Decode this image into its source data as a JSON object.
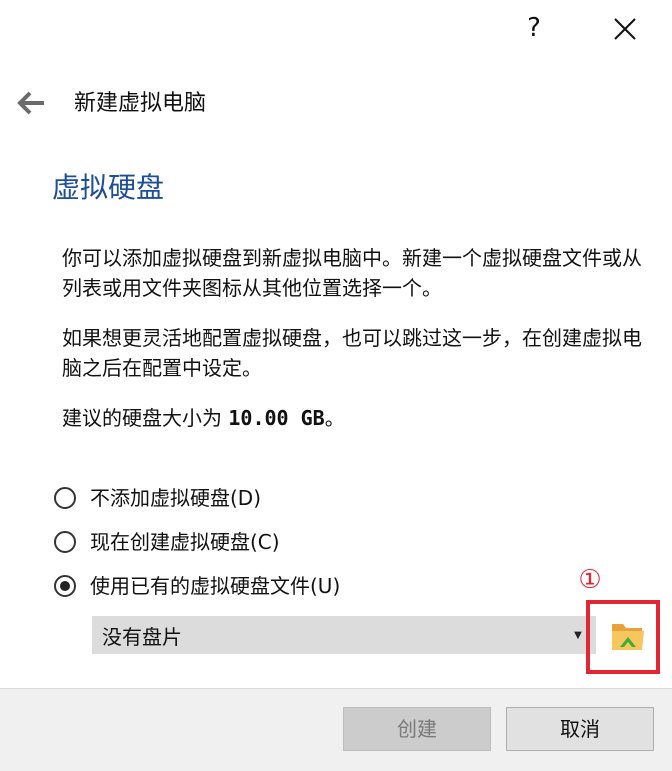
{
  "titlebar": {
    "help_label": "?",
    "close_icon": "close-icon"
  },
  "header": {
    "back_icon": "back-arrow-icon",
    "title": "新建虚拟电脑"
  },
  "section": {
    "title": "虚拟硬盘",
    "paragraph1": "你可以添加虚拟硬盘到新虚拟电脑中。新建一个虚拟硬盘文件或从列表或用文件夹图标从其他位置选择一个。",
    "paragraph2": "如果想更灵活地配置虚拟硬盘，也可以跳过这一步，在创建虚拟电脑之后在配置中设定。",
    "recommend_prefix": "建议的硬盘大小为 ",
    "recommend_size": "10.00 GB",
    "recommend_suffix": "。"
  },
  "options": [
    {
      "label": "不添加虚拟硬盘(D)",
      "checked": false
    },
    {
      "label": "现在创建虚拟硬盘(C)",
      "checked": false
    },
    {
      "label": "使用已有的虚拟硬盘文件(U)",
      "checked": true
    }
  ],
  "disk_select": {
    "value": "没有盘片",
    "folder_icon": "folder-icon"
  },
  "annotation": {
    "step": "①",
    "color": "#e32636"
  },
  "footer": {
    "create_label": "创建",
    "cancel_label": "取消"
  },
  "colors": {
    "heading": "#1f4e99",
    "highlight": "#e32636"
  }
}
